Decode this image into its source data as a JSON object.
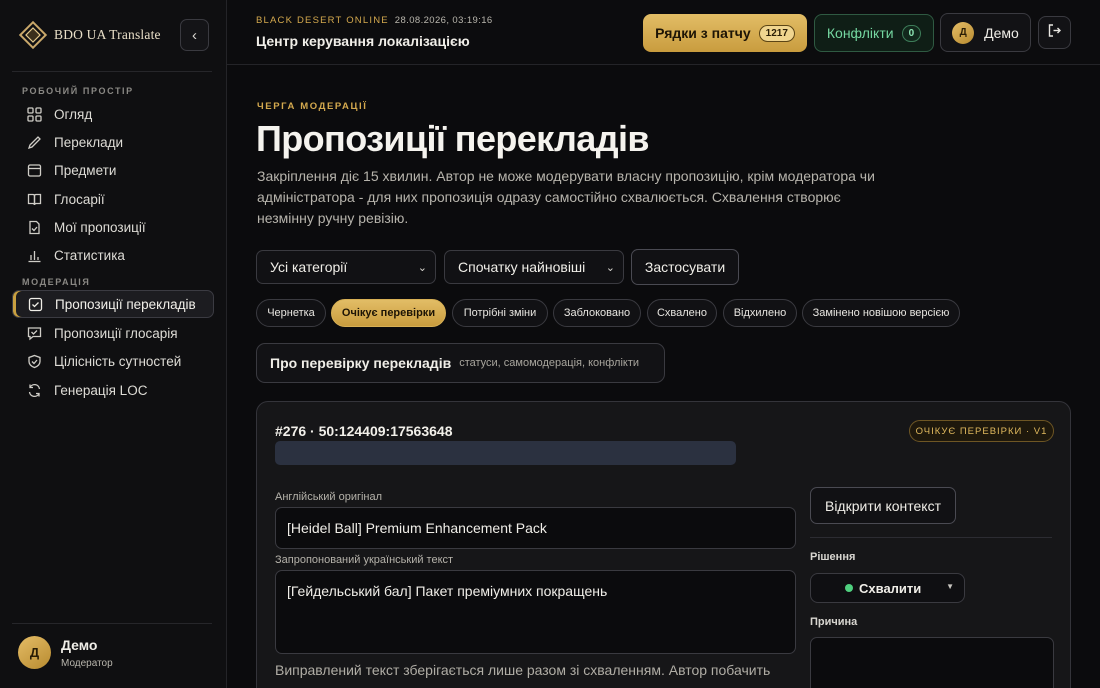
{
  "brand": {
    "name": "BDO UA Translate"
  },
  "sidebar": {
    "section_workspace": "РОБОЧИЙ ПРОСТІР",
    "section_moderation": "МОДЕРАЦІЯ",
    "items": [
      {
        "label": "Огляд",
        "icon": "grid-icon"
      },
      {
        "label": "Переклади",
        "icon": "pencil-icon"
      },
      {
        "label": "Предмети",
        "icon": "box-icon"
      },
      {
        "label": "Глосарії",
        "icon": "book-icon"
      },
      {
        "label": "Мої пропозиції",
        "icon": "document-check-icon"
      },
      {
        "label": "Статистика",
        "icon": "bar-chart-icon"
      },
      {
        "label": "Пропозиції перекладів",
        "icon": "checkbox-icon",
        "active": true
      },
      {
        "label": "Пропозиції глосарія",
        "icon": "message-check-icon"
      },
      {
        "label": "Цілісність сутностей",
        "icon": "shield-check-icon"
      },
      {
        "label": "Генерація LOC",
        "icon": "refresh-icon"
      }
    ],
    "user": {
      "initial": "Д",
      "name": "Демо",
      "role": "Модератор"
    }
  },
  "header": {
    "eyebrow": "BLACK DESERT ONLINE",
    "timestamp": "28.08.2026, 03:19:16",
    "title": "Центр керування локалізацією",
    "patch_button": "Рядки з патчу",
    "patch_count": "1217",
    "conflicts_button": "Конфлікти",
    "conflicts_count": "0",
    "user_initial": "Д",
    "user_name": "Демо"
  },
  "main": {
    "eyebrow": "ЧЕРГА МОДЕРАЦІЇ",
    "title": "Пропозиції перекладів",
    "description": "Закріплення діє 15 хвилин. Автор не може модерувати власну пропозицію, крім модератора чи адміністратора - для них пропозиція одразу самостійно схвалюється. Схвалення створює незмінну ручну ревізію.",
    "filter_category": "Усі категорії",
    "filter_sort": "Спочатку найновіші",
    "apply_button": "Застосувати",
    "status_chips": [
      "Чернетка",
      "Очікує перевірки",
      "Потрібні зміни",
      "Заблоковано",
      "Схвалено",
      "Відхилено",
      "Замінено новішою версією"
    ],
    "active_chip": "Очікує перевірки",
    "help_title": "Про перевірку перекладів",
    "help_subtitle": "статуси, самомодерація, конфлікти"
  },
  "card": {
    "id": "#276 · 50:124409:17563648",
    "status_badge": "ОЧІКУЄ ПЕРЕВІРКИ · V1",
    "original_label": "Англійський оригінал",
    "original_value": "[Heidel Ball] Premium Enhancement Pack",
    "proposed_label": "Запропонований український текст",
    "proposed_value": "[Гейдельський бал] Пакет преміумних покращень",
    "hint": "Виправлений текст зберігається лише разом зі схваленням. Автор побачить",
    "context_button": "Відкрити контекст",
    "decision_label": "Рішення",
    "decision_value": "Схвалити",
    "reason_label": "Причина"
  },
  "colors": {
    "accent_gold": "#d4a94e",
    "conflict_green": "#74d6a0",
    "approve_dot": "#4fd07f"
  }
}
